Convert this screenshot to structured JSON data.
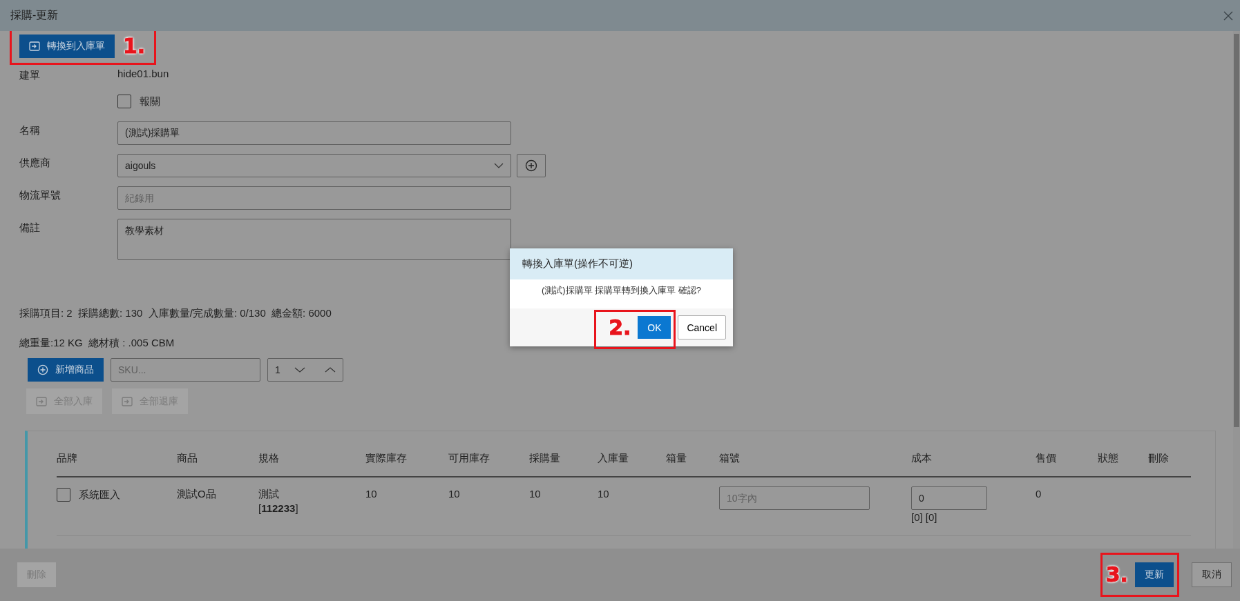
{
  "window": {
    "title": "採購-更新"
  },
  "convert_button": {
    "label": "轉換到入庫單"
  },
  "form": [
    {
      "kind": "text",
      "label": "建單",
      "value": "hide01.bun"
    },
    {
      "kind": "checkbox",
      "text": "報關",
      "checked": false
    },
    {
      "kind": "input",
      "label": "名稱",
      "value": "(測試)採購單"
    },
    {
      "kind": "select",
      "label": "供應商",
      "value": "aigouls"
    },
    {
      "kind": "input",
      "label": "物流單號",
      "placeholder": "紀錄用"
    },
    {
      "kind": "textarea",
      "label": "備註",
      "value": "教學素材"
    }
  ],
  "summary": [
    "採購項目: 2  採購總數: 130  入庫數量/完成數量: 0/130  總金額: 6000",
    "總重量:12 KG  總材積 : .005 CBM"
  ],
  "add_button": {
    "label": "新增商品",
    "disabled": false
  },
  "sku_field": {
    "placeholder": "SKU..."
  },
  "quantity_field": {
    "value": "1"
  },
  "bulk_buttons": [
    {
      "label": "全部入庫",
      "disabled": true
    },
    {
      "label": "全部退庫",
      "disabled": true
    }
  ],
  "table": {
    "columns": [
      "品牌",
      "商品",
      "規格",
      "實際庫存",
      "可用庫存",
      "採購量",
      "入庫量",
      "箱量",
      "箱號",
      "成本",
      "售價",
      "狀態",
      "刪除"
    ],
    "rows": [
      {
        "checked": false,
        "brand": "系統匯入",
        "product": "測試O品",
        "spec": "測試",
        "code": "[**112233**]",
        "stock": "10",
        "available": "10",
        "purchase": "10",
        "inbound": "10",
        "box_placeholder": "10字內",
        "cost": "0",
        "cost_note": "[0] [0]",
        "price": "0"
      }
    ]
  },
  "footer": {
    "delete": {
      "label": "刪除",
      "disabled": true
    },
    "update": {
      "label": "更新"
    },
    "cancel": {
      "label": "取消"
    }
  },
  "dialog": {
    "title": "轉換入庫單(操作不可逆)",
    "message": "(測試)採購單 採購單轉到換入庫單 確認?",
    "ok": "OK",
    "cancel": "Cancel"
  },
  "annotations": [
    "1.",
    "2.",
    "3."
  ]
}
